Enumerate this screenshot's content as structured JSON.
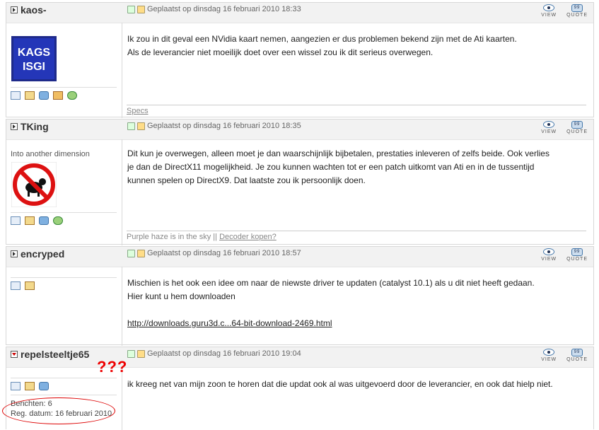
{
  "actions": {
    "view_label": "VIEW",
    "quote_label": "QUOTE"
  },
  "posts": [
    {
      "username": "kaos-",
      "posted": "Geplaatst op dinsdag 16 februari 2010 18:33",
      "avatar_text": "KAGS",
      "lines": [
        "Ik zou in dit geval een NVidia kaart nemen, aangezien er dus problemen bekend zijn met de Ati kaarten.",
        "Als de leverancier niet moeilijk doet over een wissel zou ik dit serieus overwegen."
      ],
      "signature": "Specs"
    },
    {
      "username": "TKing",
      "posted": "Geplaatst op dinsdag 16 februari 2010 18:35",
      "subtitle": "Into another dimension",
      "lines": [
        "Dit kun je overwegen, alleen moet je dan waarschijnlijk bijbetalen, prestaties inleveren of zelfs beide. Ook verlies",
        "je dan de DirectX11 mogelijkheid. Je zou kunnen wachten tot er een patch uitkomt van Ati en in de tussentijd",
        "kunnen spelen op DirectX9. Dat laatste zou ik persoonlijk doen."
      ],
      "signature_text": "Purple haze is in the sky ||",
      "signature_link": "Decoder kopen?"
    },
    {
      "username": "encryped",
      "posted": "Geplaatst op dinsdag 16 februari 2010 18:57",
      "lines": [
        "Mischien is het ook een idee om naar de niewste driver te updaten (catalyst 10.1) als u dit niet heeft gedaan.",
        "Hier kunt u hem downloaden"
      ],
      "link": "http://downloads.guru3d.c...64-bit-download-2469.html"
    },
    {
      "username": "repelsteeltje65",
      "posted": "Geplaatst op dinsdag 16 februari 2010 19:04",
      "lines": [
        "ik kreeg net van mijn zoon te horen dat die updat ook al was uitgevoerd door de leverancier, en ook dat hielp niet."
      ],
      "stats": [
        "Berichten: 6",
        "Reg. datum: 16 februari 2010"
      ]
    }
  ],
  "annotation": {
    "question_marks": "???"
  },
  "colors": {
    "annotation_red": "#dd0000",
    "header_bg": "#f2f2f2",
    "border": "#d8d8d8"
  }
}
